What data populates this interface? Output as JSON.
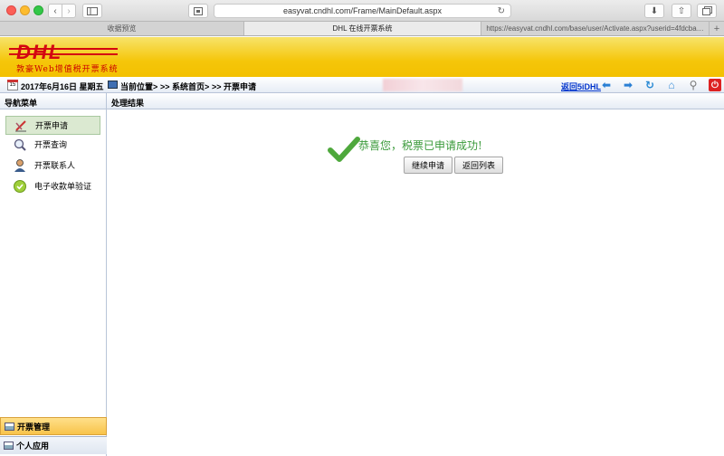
{
  "browser": {
    "url": "easyvat.cndhl.com/Frame/MainDefault.aspx",
    "tabs": [
      {
        "label": "收据预览",
        "active": false
      },
      {
        "label": "DHL 在线开票系统",
        "active": true
      },
      {
        "label": "https://easyvat.cndhl.com/base/user/Activate.aspx?userid=4fdcba…",
        "active": false
      }
    ],
    "new_tab": "+"
  },
  "banner": {
    "logo": "DHL",
    "subtitle": "敦豪Web增值税开票系统"
  },
  "infobar": {
    "date": "2017年6月16日 星期五",
    "location_label": "当前位置>",
    "crumb_1": ">> 系统首页>",
    "crumb_2": ">> 开票申请",
    "back_link": "返回5iDHL",
    "calendar_day": "15"
  },
  "leftnav": {
    "header": "导航菜单",
    "items": [
      {
        "label": "开票申请",
        "icon": "pen-icon",
        "active": true
      },
      {
        "label": "开票查询",
        "icon": "magnifier-icon",
        "active": false
      },
      {
        "label": "开票联系人",
        "icon": "person-icon",
        "active": false
      },
      {
        "label": "电子收款单验证",
        "icon": "check-circle-icon",
        "active": false
      }
    ],
    "bottom_tabs": [
      {
        "label": "开票管理",
        "active": true
      },
      {
        "label": "个人应用",
        "active": false
      }
    ]
  },
  "content": {
    "header": "处理结果",
    "message": "恭喜您，税票已申请成功!",
    "continue_button": "继续申请",
    "back_button": "返回列表"
  },
  "colors": {
    "accent_yellow": "#f5c60a",
    "dhl_red": "#d40511",
    "success_green": "#3a9a3a"
  }
}
